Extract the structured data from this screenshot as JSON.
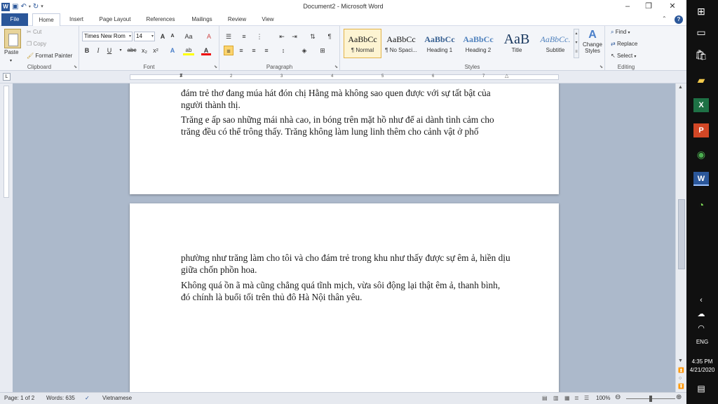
{
  "window": {
    "title": "Document2 - Microsoft Word",
    "help_icon": "question-icon"
  },
  "qat": {
    "icons": [
      "word-logo-icon",
      "save-icon",
      "undo-icon",
      "redo-icon",
      "customize-icon"
    ]
  },
  "tabs": [
    {
      "label": "File"
    },
    {
      "label": "Home"
    },
    {
      "label": "Insert"
    },
    {
      "label": "Page Layout"
    },
    {
      "label": "References"
    },
    {
      "label": "Mailings"
    },
    {
      "label": "Review"
    },
    {
      "label": "View"
    }
  ],
  "active_tab": "Home",
  "ribbon": {
    "clipboard": {
      "label": "Clipboard",
      "paste": "Paste",
      "cut": "Cut",
      "copy": "Copy",
      "format_painter": "Format Painter"
    },
    "font": {
      "label": "Font",
      "font_name": "Times New Rom",
      "font_size": "14",
      "bold": "B",
      "italic": "I",
      "underline": "U",
      "strike": "abc",
      "sub": "x₂",
      "sup": "x²",
      "grow": "A",
      "shrink": "A",
      "change_case": "Aa",
      "clear": "A",
      "text_effects": "A",
      "highlight": "ab",
      "font_color": "A"
    },
    "paragraph": {
      "label": "Paragraph"
    },
    "styles": {
      "label": "Styles",
      "change_styles": "Change Styles",
      "items": [
        {
          "sample": "AaBbCc",
          "name": "¶ Normal",
          "color": "#111111"
        },
        {
          "sample": "AaBbCc",
          "name": "¶ No Spaci...",
          "color": "#111111"
        },
        {
          "sample": "AaBbCc",
          "name": "Heading 1",
          "color": "#365f91"
        },
        {
          "sample": "AaBbCc",
          "name": "Heading 2",
          "color": "#4f81bd"
        },
        {
          "sample": "AaB",
          "name": "Title",
          "color": "#17365d"
        },
        {
          "sample": "AaBbCc.",
          "name": "Subtitle",
          "color": "#4f81bd"
        }
      ]
    },
    "editing": {
      "label": "Editing",
      "find": "Find",
      "replace": "Replace",
      "select": "Select"
    }
  },
  "ruler": {
    "numbers": [
      "1",
      "2",
      "3",
      "4",
      "5",
      "6",
      "7"
    ]
  },
  "document": {
    "page1": [
      "đám trẻ thơ đang múa hát đón chị Hằng mà không sao quen được với sự tất bật của người thành thị.",
      "Trăng e ấp sao những mái nhà cao, in bóng trên mặt hồ như để ai dành tình cảm cho trăng đều có thể trông thấy. Trăng không làm lung linh thêm cho cảnh vật ở phố"
    ],
    "page2": [
      "phường như trăng làm cho tôi và cho đám trẻ trong khu như thấy được sự êm ả, hiền dịu giữa chốn phồn hoa.",
      "Không quá ồn ã mà cũng chẳng quá tĩnh mịch, vừa sôi động lại thật êm ả, thanh bình, đó chính là buổi tối trên thủ đô Hà Nội thân yêu."
    ]
  },
  "status": {
    "page": "Page: 1 of 2",
    "words": "Words: 635",
    "language": "Vietnamese",
    "zoom": "100%",
    "zoom_level": 1.0
  },
  "taskbar": {
    "lang": "ENG",
    "time": "4:35 PM",
    "date": "4/21/2020"
  },
  "colors": {
    "accent": "#2b579a",
    "file_tab": "#2a5699"
  }
}
